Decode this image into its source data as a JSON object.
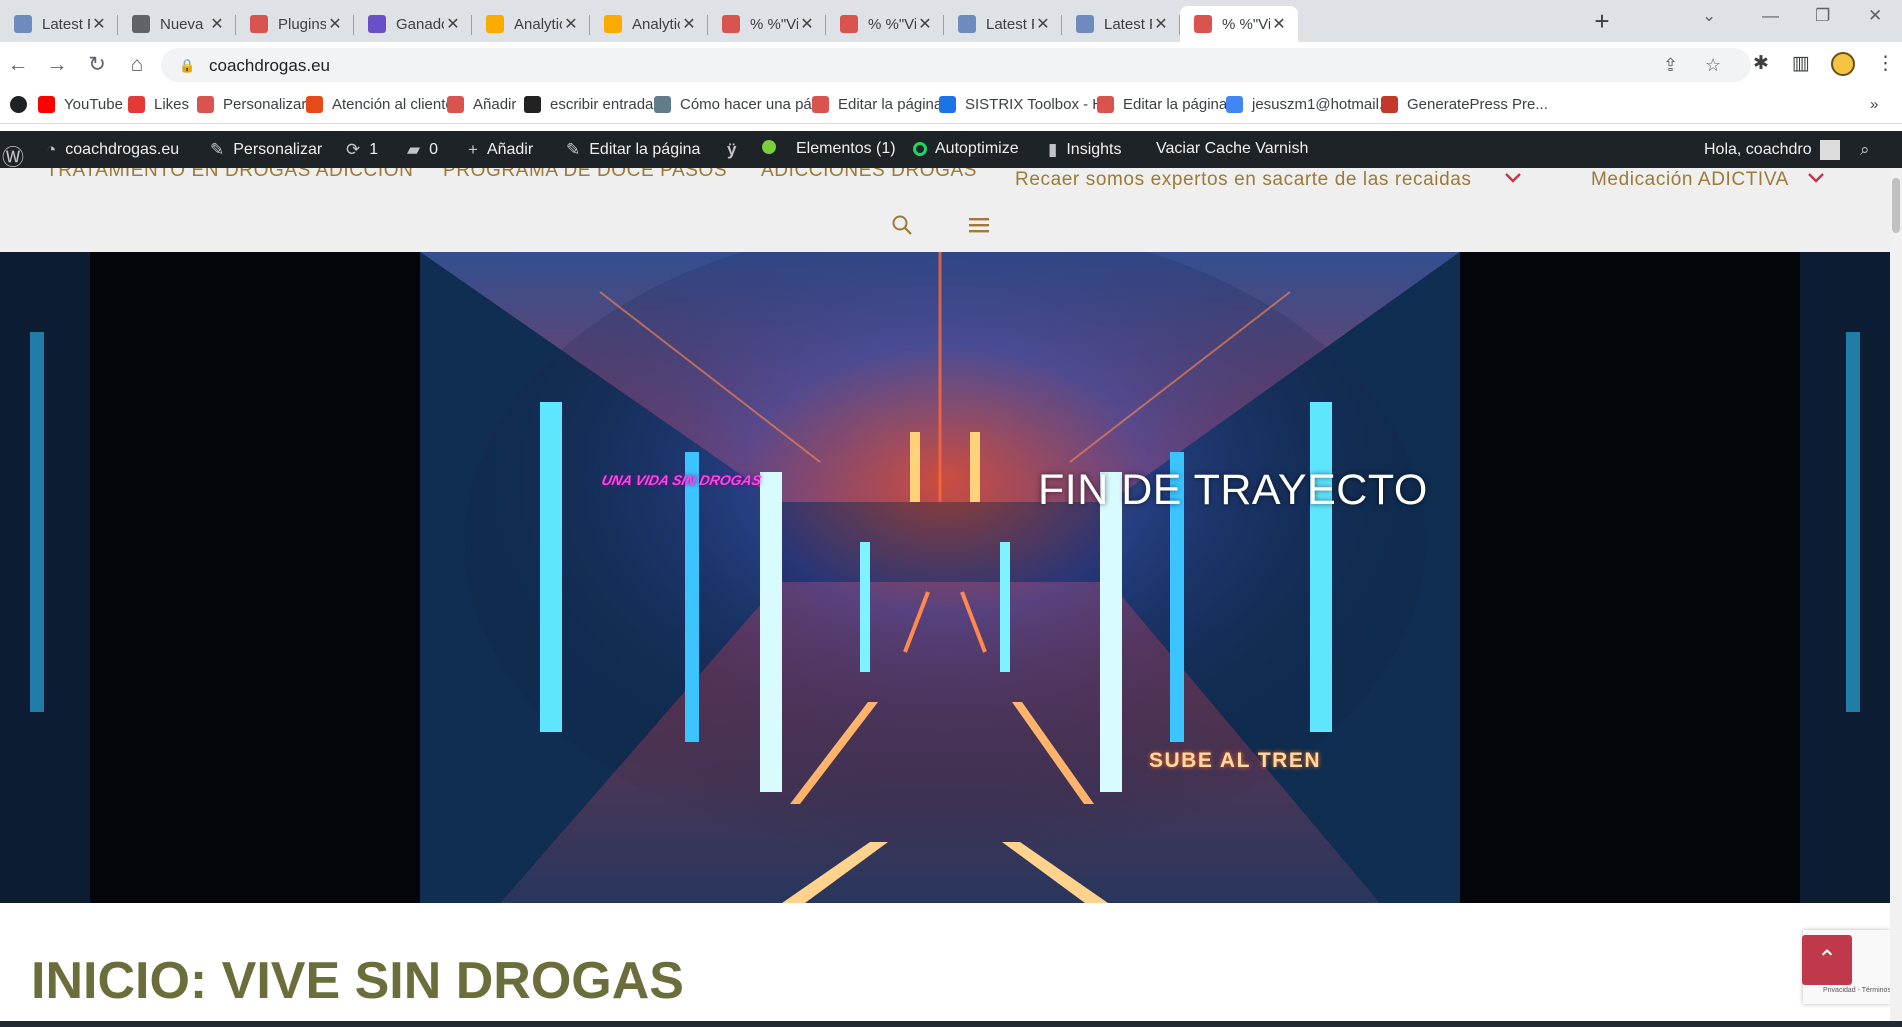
{
  "browser": {
    "tabs": [
      {
        "title": "Latest Per",
        "favicon": "gt-favicon",
        "color": "#6d8bbd",
        "active": false
      },
      {
        "title": "Nueva pe",
        "favicon": "chrome-favicon",
        "color": "#5f6368",
        "active": false
      },
      {
        "title": "Plugins «",
        "favicon": "site-favicon",
        "color": "#d9534f",
        "active": false
      },
      {
        "title": "Ganador",
        "favicon": "ganador-favicon",
        "color": "#6a4fc7",
        "active": false
      },
      {
        "title": "Analytics",
        "favicon": "analytics-favicon",
        "color": "#f9ab00",
        "active": false
      },
      {
        "title": "Analytics",
        "favicon": "analytics-favicon",
        "color": "#f9ab00",
        "active": false
      },
      {
        "title": "% %\"Vivi",
        "favicon": "site-favicon",
        "color": "#d9534f",
        "active": false
      },
      {
        "title": "% %\"Vivi",
        "favicon": "site-favicon",
        "color": "#d9534f",
        "active": false
      },
      {
        "title": "Latest Per",
        "favicon": "gt-favicon",
        "color": "#6d8bbd",
        "active": false
      },
      {
        "title": "Latest Per",
        "favicon": "gt-favicon",
        "color": "#6d8bbd",
        "active": false
      },
      {
        "title": "% %\"Vivi",
        "favicon": "site-favicon",
        "color": "#d9534f",
        "active": true
      }
    ],
    "url": "coachdrogas.eu",
    "bookmarks": [
      {
        "label": "YouTube",
        "icon": "youtube-icon",
        "color": "#ff0000"
      },
      {
        "label": "Likes",
        "icon": "n-icon",
        "color": "#e53935"
      },
      {
        "label": "Personalizar",
        "icon": "site-icon",
        "color": "#d9534f"
      },
      {
        "label": "Atención al cliente",
        "icon": "support-icon",
        "color": "#e64a19"
      },
      {
        "label": "Añadir",
        "icon": "site-icon",
        "color": "#d9534f"
      },
      {
        "label": "escribir entradas",
        "icon": "dollar-icon",
        "color": "#222222"
      },
      {
        "label": "Cómo hacer una pá...",
        "icon": "page-icon",
        "color": "#607d8b"
      },
      {
        "label": "Editar la página",
        "icon": "site-icon",
        "color": "#d9534f"
      },
      {
        "label": "SISTRIX Toolbox - H...",
        "icon": "search-icon",
        "color": "#1a73e8"
      },
      {
        "label": "Editar la página",
        "icon": "site-icon",
        "color": "#d9534f"
      },
      {
        "label": "jesuszm1@hotmail....",
        "icon": "google-icon",
        "color": "#4285f4"
      },
      {
        "label": "GeneratePress Pre...",
        "icon": "generatepress-icon",
        "color": "#c0392b"
      }
    ],
    "bookmarks_more": "»"
  },
  "adminbar": {
    "site": "coachdrogas.eu",
    "customize": "Personalizar",
    "updates": "1",
    "comments": "0",
    "add_new": "Añadir",
    "edit_page": "Editar la página",
    "elements": "Elementos (1)",
    "autoptimize": "Autoptimize",
    "insights": "Insights",
    "varnish": "Vaciar Cache Varnish",
    "greeting": "Hola, coachdro"
  },
  "nav": {
    "items": [
      {
        "label": "TRATAMIENTO EN DROGAS ADICCION",
        "has_dropdown": false
      },
      {
        "label": "PROGRAMA DE DOCE PASOS",
        "has_dropdown": false
      },
      {
        "label": "ADICCIONES DROGAS",
        "has_dropdown": false
      },
      {
        "label": "Recaer somos expertos en sacarte de las recaidas",
        "has_dropdown": true
      },
      {
        "label": "Medicación ADICTIVA",
        "has_dropdown": true
      }
    ],
    "accent": "#9c7a37",
    "chevron_color": "#c0394b"
  },
  "hero": {
    "title": "FIN DE TRAYECTO",
    "tagline": "UNA VIDA SIN DROGAS",
    "cta": "SUBE AL TREN"
  },
  "page": {
    "title": "INICIO: VIVE SIN DROGAS",
    "title_color": "#6b6e3a",
    "recaptcha_text": "Privacidad - Términos"
  }
}
